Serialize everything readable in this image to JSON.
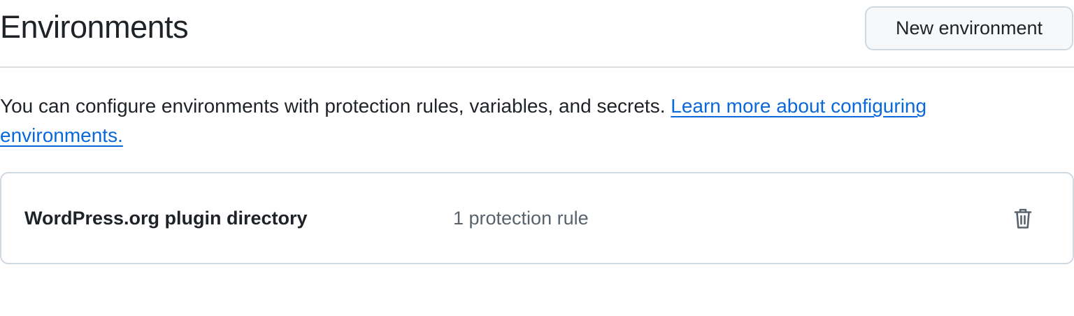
{
  "header": {
    "title": "Environments",
    "new_button_label": "New environment"
  },
  "description": {
    "text": "You can configure environments with protection rules, variables, and secrets. ",
    "link_text": "Learn more about configuring environments."
  },
  "environments": [
    {
      "name": "WordPress.org plugin directory",
      "rules": "1 protection rule",
      "action_icon": "trash-icon"
    }
  ],
  "colors": {
    "link": "#0969da",
    "muted_text": "#59636e",
    "border": "#d1d9e0",
    "button_bg": "#f6f8fa"
  }
}
